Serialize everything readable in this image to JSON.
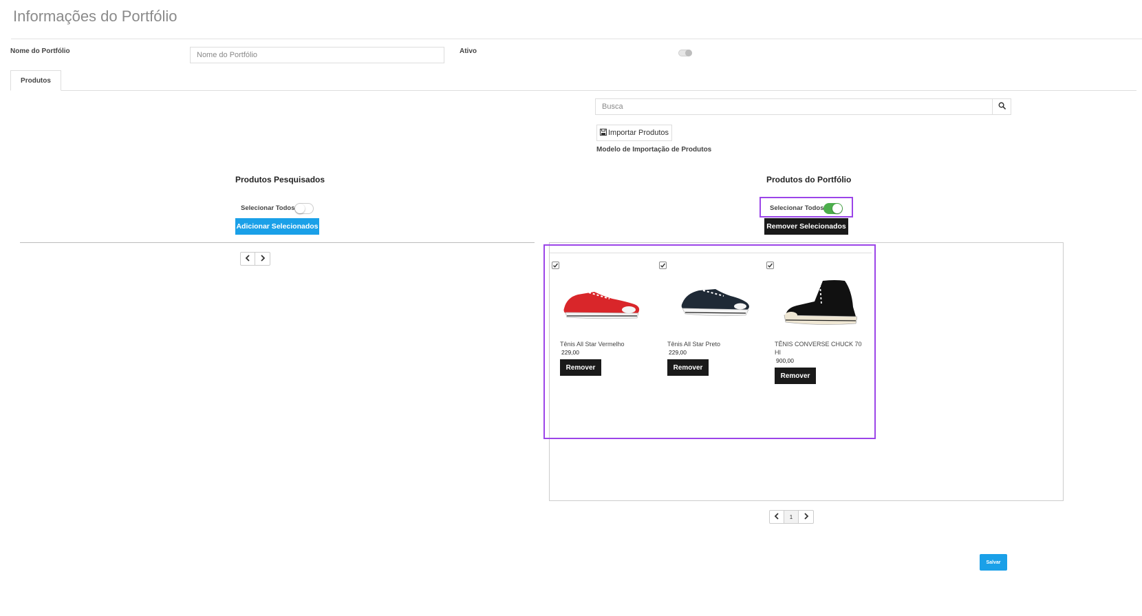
{
  "header": {
    "title": "Informações do Portfólio"
  },
  "form": {
    "name_label": "Nome do Portfólio",
    "name_placeholder": "Nome do Portfólio",
    "name_value": "",
    "active_label": "Ativo",
    "active_on": false
  },
  "tabs": [
    {
      "label": "Produtos",
      "active": true
    }
  ],
  "search": {
    "placeholder": "Busca",
    "value": ""
  },
  "import": {
    "button_label": "Importar Produtos",
    "template_link": "Modelo de Importação de Produtos"
  },
  "searched": {
    "title": "Produtos Pesquisados",
    "select_all_label": "Selecionar Todos",
    "select_all_on": false,
    "add_button": "Adicionar Selecionados"
  },
  "portfolio": {
    "title": "Produtos do Portfólio",
    "select_all_label": "Selecionar Todos",
    "select_all_on": true,
    "remove_button": "Remover Selecionados",
    "products": [
      {
        "name": "Tênis All Star Vermelho",
        "price": "229,00",
        "checked": true,
        "remove_label": "Remover",
        "color": "#d9262a"
      },
      {
        "name": "Tênis All Star Preto",
        "price": "229,00",
        "checked": true,
        "remove_label": "Remover",
        "color": "#1f2a36"
      },
      {
        "name": "TÊNIS CONVERSE CHUCK 70 HI",
        "price": "900,00",
        "checked": true,
        "remove_label": "Remover",
        "color": "#111111"
      }
    ],
    "pager": {
      "current_page": "1"
    }
  },
  "footer": {
    "save_label": "Salvar"
  },
  "colors": {
    "accent_blue": "#1aa0e8",
    "toggle_green": "#4cae4c",
    "highlight": "#9b44e8",
    "dark_button": "#1a1a1a"
  }
}
